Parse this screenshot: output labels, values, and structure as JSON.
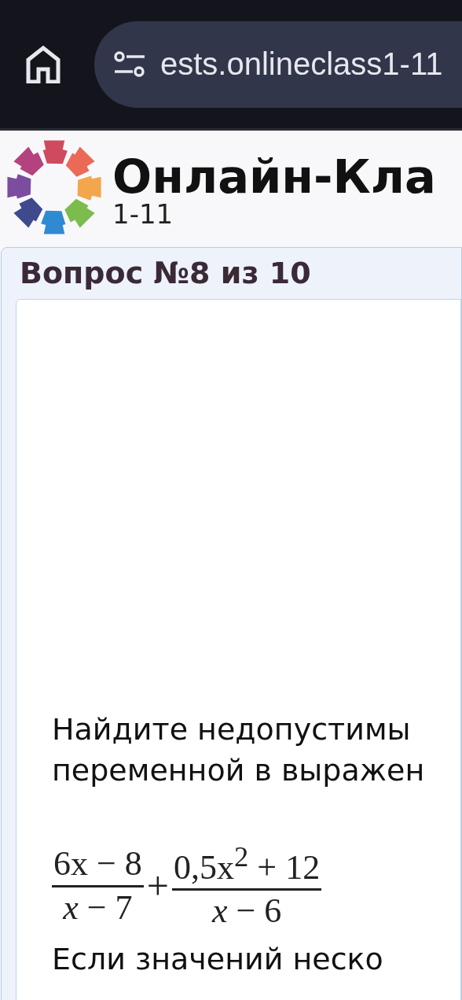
{
  "browser": {
    "url": "ests.onlineclass1-11"
  },
  "site": {
    "title": "Онлайн-Кла",
    "subtitle": "1-11"
  },
  "question": {
    "heading": "Вопрос №8 из 10",
    "lines": [
      "Найдите недопустимы",
      "переменной в выражен"
    ],
    "formula": {
      "terms": [
        {
          "numerator": "6x − 8",
          "denominator": "*x* − 7"
        },
        {
          "numerator": "0,5x$^{2}$ + 12",
          "denominator": "*x* − 6"
        }
      ],
      "operator": "+"
    },
    "footer_line": "Если значений неско"
  }
}
